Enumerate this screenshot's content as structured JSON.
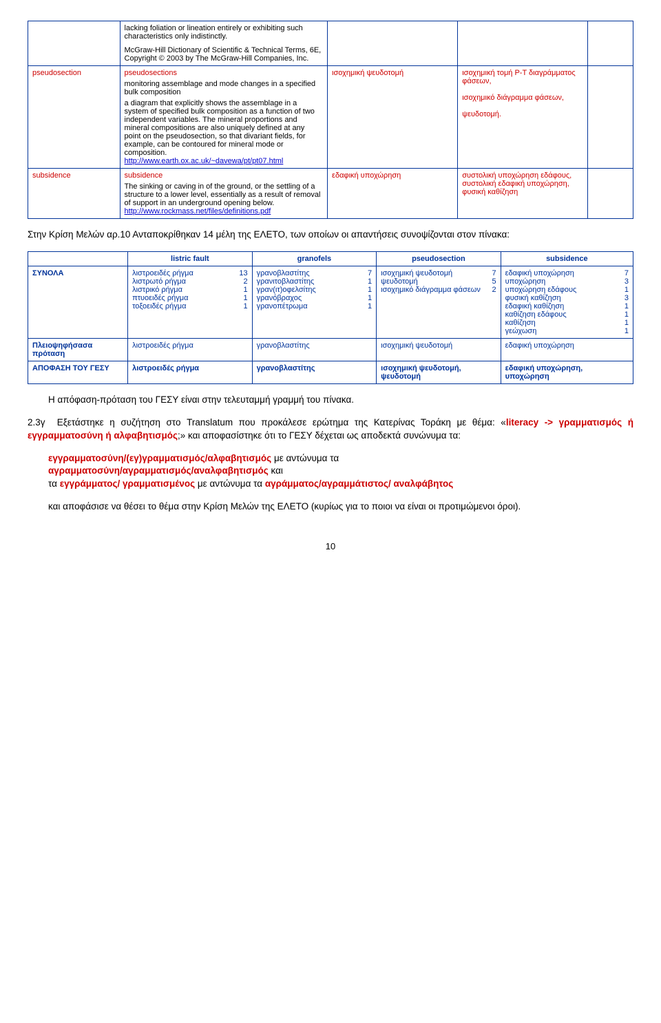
{
  "table1": {
    "row1": {
      "text1": "lacking foliation or lineation entirely or exhibiting such characteristics only indistinctly.",
      "text2": "McGraw-Hill Dictionary of Scientific & Technical Terms, 6E, Copyright © 2003 by The McGraw-Hill Companies, Inc."
    },
    "row2": {
      "c1": "pseudosection",
      "h": "pseudosections",
      "t1": "monitoring assemblage and mode changes in a specified bulk composition",
      "t2": "a diagram that explicitly shows the assemblage in a system of specified bulk composition as a function of two independent variables. The mineral proportions and mineral compositions are also uniquely defined at any point on the pseudosection, so that divariant fields, for example, can be contoured for mineral mode or composition.",
      "link": "http://www.earth.ox.ac.uk/~davewa/pt/pt07.html",
      "c3": "ισοχημική ψευδοτομή",
      "c4": "ισοχημική τομή P-T διαγράμματος φάσεων,\n\nισοχημικό διάγραμμα φάσεων,\n\nψευδοτομή."
    },
    "row3": {
      "c1": "subsidence",
      "h": "subsidence",
      "t1": "The sinking or caving in of the ground, or the settling of a structure to a lower level, essentially as a result of removal of support in an underground opening below.",
      "link": "http://www.rockmass.net/files/definitions.pdf",
      "c3": "εδαφική υποχώρηση",
      "c4": "συστολική υποχώρηση εδάφους, συστολική εδαφική υποχώρηση, φυσική καθίζηση"
    }
  },
  "para1": "Στην Κρίση Μελών αρ.10 Ανταποκρίθηκαν 14 μέλη της ΕΛΕΤΟ, των οποίων οι απαντήσεις συνοψίζονται στον πίνακα:",
  "table2": {
    "headers": {
      "c1": "",
      "c2": "listric fault",
      "c3": "granofels",
      "c4": "pseudosection",
      "c5": "subsidence"
    },
    "row1": {
      "label": "ΣΥΝΟΛΑ",
      "c2": [
        [
          "λιστροειδές ρήγμα",
          "13"
        ],
        [
          "λιστρωτό ρήγμα",
          "2"
        ],
        [
          "λιστρικό ρήγμα",
          "1"
        ],
        [
          "πτυοειδές ρήγμα",
          "1"
        ],
        [
          "τοξοειδές ρήγμα",
          "1"
        ]
      ],
      "c3": [
        [
          "γρανοβλαστίτης",
          "7"
        ],
        [
          "γρανιτοβλαστίτης",
          "1"
        ],
        [
          "γραν(ιτ)οφελσίτης",
          "1"
        ],
        [
          "γρανόβραχος",
          "1"
        ],
        [
          "γρανοπέτρωμα",
          "1"
        ]
      ],
      "c4": [
        [
          "ισοχημική ψευδοτομή",
          "7"
        ],
        [
          "ψευδοτομή",
          "5"
        ],
        [
          "ισοχημικό διάγραμμα φάσεων",
          "2"
        ]
      ],
      "c5": [
        [
          "εδαφική υποχώρηση",
          "7"
        ],
        [
          "υποχώρηση",
          "3"
        ],
        [
          "υποχώρηση εδάφους",
          "1"
        ],
        [
          "φυσική καθίζηση",
          "3"
        ],
        [
          "εδαφική καθίζηση",
          "1"
        ],
        [
          "καθίζηση εδάφους",
          "1"
        ],
        [
          "καθίζηση",
          "1"
        ],
        [
          "γεώχωση",
          "1"
        ]
      ]
    },
    "row2": {
      "label": "Πλειοψηφήσασα πρόταση",
      "c2": "λιστροειδές ρήγμα",
      "c3": "γρανοβλαστίτης",
      "c4": "ισοχημική ψευδοτομή",
      "c5": "εδαφική υποχώρηση"
    },
    "row3": {
      "label": "ΑΠΟΦΑΣΗ ΤΟΥ ΓΕΣΥ",
      "c2": "λιστροειδές ρήγμα",
      "c3": "γρανοβλαστίτης",
      "c4": "ισοχημική ψευδοτομή, ψευδοτομή",
      "c5": "εδαφική υποχώρηση, υποχώρηση"
    }
  },
  "para2": "Η απόφαση-πρόταση του ΓΕΣΥ είναι στην τελευταμμή γραμμή του πίνακα.",
  "para3": {
    "prefix": "2.3γ",
    "t1": "Εξετάστηκε η συζήτηση στο Translatum που προκάλεσε ερώτημα της Κατερίνας Τοράκη με θέμα: «",
    "r1": "literacy -> γραμματισμός ή εγγραμματοσύνη ή αλφαβητισμός",
    "t2": ";» και αποφασίστηκε ότι το ΓΕΣΥ δέχεται ως αποδεκτά συνώνυμα τα:"
  },
  "bullets": {
    "b1a": "εγγραμματοσύνη/(εγ)γραμματισμός/αλφαβητισμός",
    "b1b": " με αντώνυμα τα",
    "b2a": "αγραμματοσύνη/αγραμματισμός/αναλφαβητισμός",
    "b2b": " και",
    "b3a": "τα ",
    "b3b": "εγγράμματος/ γραμματισμένος",
    "b3c": " με αντώνυμα τα ",
    "b3d": "αγράμματος/αγραμμάτιστος/ αναλφάβητος",
    "b4": "και αποφάσισε να θέσει το θέμα στην Κρίση Μελών της ΕΛΕΤΟ (κυρίως για το ποιοι να είναι οι προτιμώμενοι όροι)."
  },
  "pagenum": "10"
}
